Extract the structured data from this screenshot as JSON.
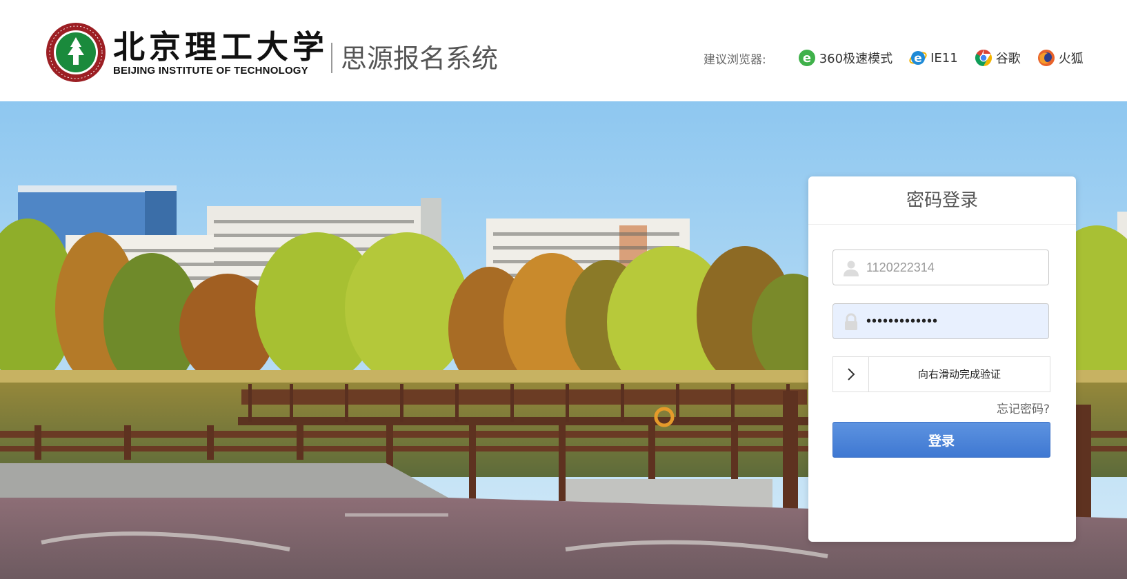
{
  "header": {
    "brand_cn": "北京理工大学",
    "brand_en": "BEIJING INSTITUTE OF TECHNOLOGY",
    "system_title": "思源报名系统",
    "browsers_label": "建议浏览器:",
    "browsers": [
      {
        "name": "360极速模式",
        "icon": "360-browser-icon"
      },
      {
        "name": "IE11",
        "icon": "ie-icon"
      },
      {
        "name": "谷歌",
        "icon": "chrome-icon"
      },
      {
        "name": "火狐",
        "icon": "firefox-icon"
      }
    ]
  },
  "login": {
    "title": "密码登录",
    "username_value": "1120222314",
    "password_value": "•••••••••••••",
    "slider_text": "向右滑动完成验证",
    "forgot_label": "忘记密码?",
    "submit_label": "登录"
  },
  "colors": {
    "accent": "#4a82d6",
    "sky": "#a9d2f2",
    "header_bg": "#ffffff"
  }
}
